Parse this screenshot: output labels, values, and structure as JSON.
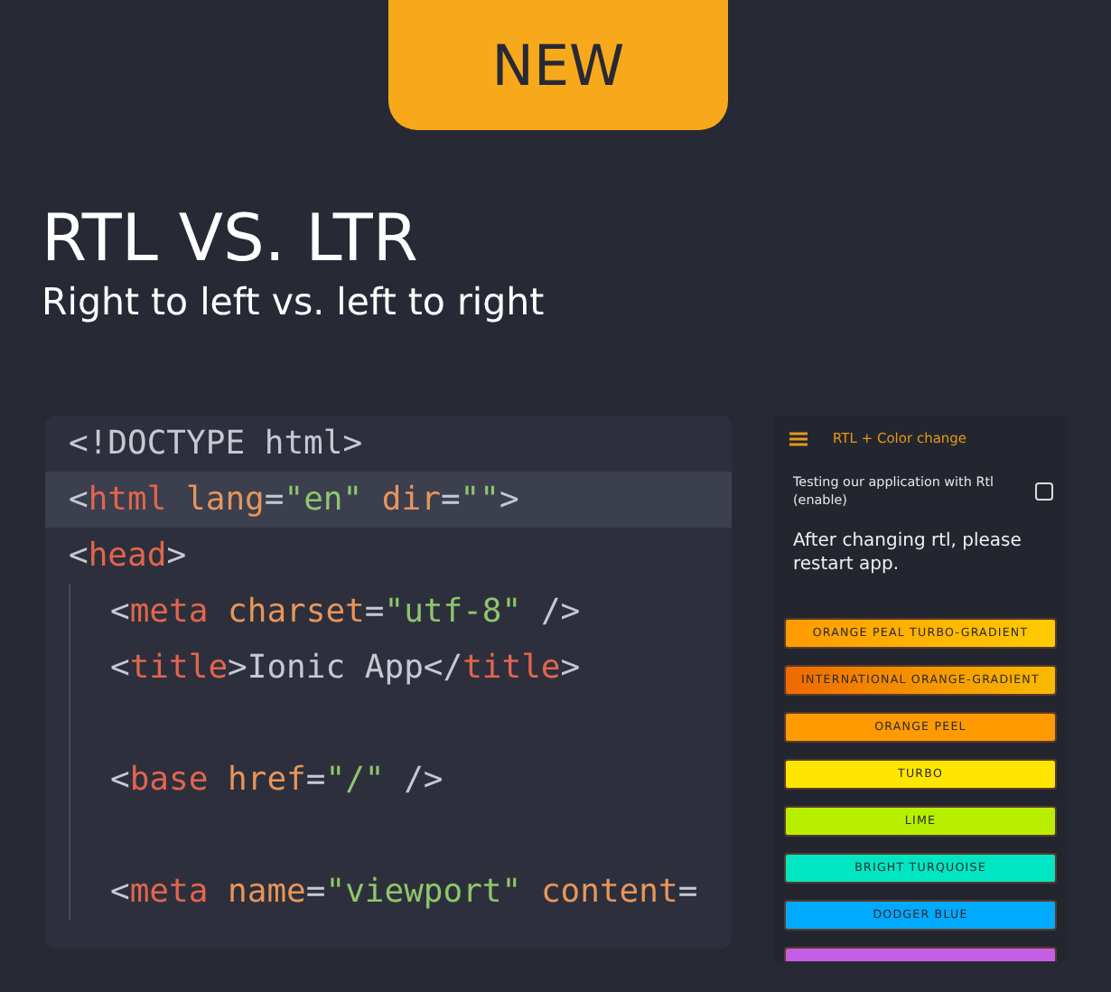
{
  "badge": {
    "label": "NEW"
  },
  "heading": {
    "title": "RTL VS. LTR",
    "subtitle": "Right to left vs. left to right"
  },
  "code_editor": {
    "lines": [
      {
        "kind": "code",
        "highlighted": false,
        "tokens": [
          {
            "kind": "punct",
            "text": "<!DOCTYPE html>"
          }
        ]
      },
      {
        "kind": "code",
        "highlighted": true,
        "tokens": [
          {
            "kind": "punct",
            "text": "<"
          },
          {
            "kind": "tag",
            "text": "html"
          },
          {
            "kind": "attr",
            "text": " lang"
          },
          {
            "kind": "punct",
            "text": "="
          },
          {
            "kind": "string",
            "text": "\"en\""
          },
          {
            "kind": "attr",
            "text": " dir"
          },
          {
            "kind": "punct",
            "text": "="
          },
          {
            "kind": "string",
            "text": "\"\""
          },
          {
            "kind": "punct",
            "text": ">"
          }
        ]
      },
      {
        "kind": "code",
        "highlighted": false,
        "tokens": [
          {
            "kind": "punct",
            "text": "<"
          },
          {
            "kind": "tag",
            "text": "head"
          },
          {
            "kind": "punct",
            "text": ">"
          }
        ],
        "children": [
          {
            "kind": "code",
            "highlighted": false,
            "tokens": [
              {
                "kind": "punct",
                "text": "<"
              },
              {
                "kind": "tag",
                "text": "meta"
              },
              {
                "kind": "attr",
                "text": " charset"
              },
              {
                "kind": "punct",
                "text": "="
              },
              {
                "kind": "string",
                "text": "\"utf-8\""
              },
              {
                "kind": "punct",
                "text": " />"
              }
            ]
          },
          {
            "kind": "code",
            "highlighted": false,
            "tokens": [
              {
                "kind": "punct",
                "text": "<"
              },
              {
                "kind": "tag",
                "text": "title"
              },
              {
                "kind": "punct",
                "text": ">Ionic App</"
              },
              {
                "kind": "tag",
                "text": "title"
              },
              {
                "kind": "punct",
                "text": ">"
              }
            ]
          },
          {
            "kind": "blank",
            "highlighted": false
          },
          {
            "kind": "code",
            "highlighted": false,
            "tokens": [
              {
                "kind": "punct",
                "text": "<"
              },
              {
                "kind": "tag",
                "text": "base"
              },
              {
                "kind": "attr",
                "text": " href"
              },
              {
                "kind": "punct",
                "text": "="
              },
              {
                "kind": "string",
                "text": "\"/\""
              },
              {
                "kind": "punct",
                "text": " />"
              }
            ]
          },
          {
            "kind": "blank",
            "highlighted": false
          },
          {
            "kind": "code",
            "highlighted": false,
            "tokens": [
              {
                "kind": "punct",
                "text": "<"
              },
              {
                "kind": "tag",
                "text": "meta"
              },
              {
                "kind": "attr",
                "text": " name"
              },
              {
                "kind": "punct",
                "text": "="
              },
              {
                "kind": "string",
                "text": "\"viewport\""
              },
              {
                "kind": "attr",
                "text": " content"
              },
              {
                "kind": "punct",
                "text": "="
              }
            ]
          }
        ]
      }
    ]
  },
  "phone": {
    "toolbar_title": "RTL + Color change",
    "rtl_option": {
      "label": "Testing our application with Rtl (enable)",
      "checked": false
    },
    "notice": "After changing rtl, please restart app.",
    "color_buttons": [
      {
        "kind": "gradient",
        "label": "ORANGE PEAL TURBO-GRADIENT",
        "color": "#ff9a00"
      },
      {
        "kind": "gradient",
        "label": "INTERNATIONAL ORANGE-GRADIENT",
        "color": "#ee6a00"
      },
      {
        "kind": "solid",
        "label": "ORANGE PEEL",
        "color": "#ff9a00"
      },
      {
        "kind": "solid",
        "label": "TURBO",
        "color": "#ffe600"
      },
      {
        "kind": "solid",
        "label": "LIME",
        "color": "#b8ef00"
      },
      {
        "kind": "solid",
        "label": "BRIGHT TURQUOISE",
        "color": "#00e6c3"
      },
      {
        "kind": "solid",
        "label": "DODGER BLUE",
        "color": "#00aaff"
      },
      {
        "kind": "solid",
        "color": "#c65ee6"
      }
    ]
  }
}
